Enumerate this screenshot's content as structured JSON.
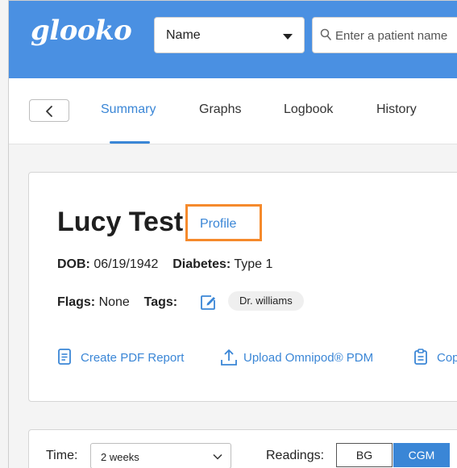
{
  "header": {
    "logo": "glooko",
    "search_by": {
      "selected": "Name"
    },
    "search": {
      "placeholder": "Enter a patient name"
    }
  },
  "nav": {
    "tabs": [
      {
        "label": "Summary",
        "active": true
      },
      {
        "label": "Graphs"
      },
      {
        "label": "Logbook"
      },
      {
        "label": "History"
      }
    ]
  },
  "patient": {
    "name": "Lucy Test",
    "profile_link": "Profile",
    "dob_label": "DOB:",
    "dob": "06/19/1942",
    "diabetes_label": "Diabetes:",
    "diabetes": "Type 1",
    "flags_label": "Flags:",
    "flags": "None",
    "tags_label": "Tags:",
    "tags": [
      "Dr. williams"
    ],
    "actions": {
      "create_pdf": "Create PDF Report",
      "upload": "Upload Omnipod® PDM",
      "copy": "Cop"
    }
  },
  "filters": {
    "time_label": "Time:",
    "time_value": "2 weeks",
    "readings_label": "Readings:",
    "readings_options": [
      "BG",
      "CGM"
    ],
    "readings_selected": "CGM"
  },
  "colors": {
    "brand_blue": "#4a90e2",
    "link_blue": "#3a86d6",
    "highlight_orange": "#f58a2c"
  }
}
